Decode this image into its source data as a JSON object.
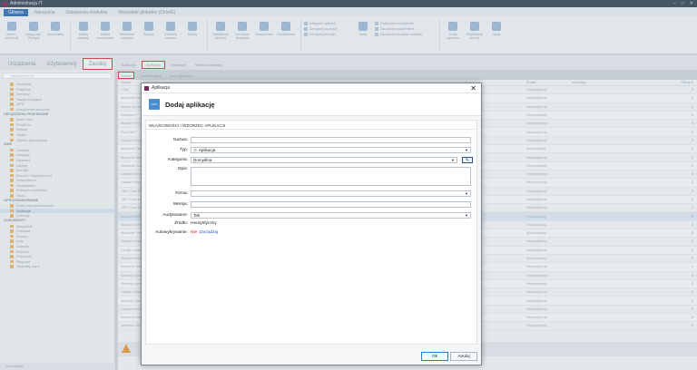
{
  "app": {
    "title": "Administracja IT"
  },
  "menu_tabs": [
    "Główna",
    "Narzędzia",
    "Ustawienia modułów",
    "Wszystkie globalne (CtrlwG)"
  ],
  "ribbon": {
    "buttons": [
      "Zmień / wzmocnij",
      "Zaloguj się / Wyloguj",
      "Komunikaty",
      "Zdalny desktop",
      "Zdalne zarządzanie",
      "Biblioteka urządzeń",
      "Raporty",
      "Dziennik zdarzeń",
      "Alarmy",
      "Ustawienia skanera",
      "Usuwanie zbędnych",
      "Skanuj teraz",
      "Uprawnienia"
    ],
    "list_a": [
      "Kategorie aplikacji",
      "Zarządzaj wzorcami",
      "Konfiguruj licencje"
    ],
    "list_b": [
      "Podłączone urządzenia",
      "Zarządzaj urządzeniami",
      "Zarządzaj zasobami zdalnymi"
    ],
    "tail_buttons": [
      "Audyt",
      "Audyt zgłoszeń",
      "Rejestracja licencji",
      "Opcje"
    ]
  },
  "sub_tabs": [
    "Urządzenia",
    "Użytkownicy",
    "Zasoby"
  ],
  "sub_tabs2": [
    "Aplikacje",
    "Aplikacje",
    "Instalacje",
    "Historia instalacji"
  ],
  "toolbar": {
    "add": "Dodaj",
    "edit": "Zmień/edytuj",
    "delete": "Usuń aplikacje"
  },
  "sidebar": {
    "search_placeholder": "Szukaj (Ctrl+F)",
    "items": [
      {
        "type": "it",
        "label": "Drukarka"
      },
      {
        "type": "it",
        "label": "Projektor"
      },
      {
        "type": "it",
        "label": "Serwery"
      },
      {
        "type": "it",
        "label": "Stacja dokująca"
      },
      {
        "type": "it",
        "label": "UPS"
      },
      {
        "type": "it",
        "label": "Urządzenie sieciowe"
      },
      {
        "type": "grp",
        "label": "URZĄDZENIA PRZENOŚNE"
      },
      {
        "type": "it",
        "label": "Karta SIM"
      },
      {
        "type": "it",
        "label": "Pendrive"
      },
      {
        "type": "it",
        "label": "Skaner"
      },
      {
        "type": "it",
        "label": "Tablet"
      },
      {
        "type": "it",
        "label": "Telefon komórkowy"
      },
      {
        "type": "grp",
        "label": "INNE"
      },
      {
        "type": "it",
        "label": "Comfort"
      },
      {
        "type": "it",
        "label": "Dostępy"
      },
      {
        "type": "it",
        "label": "Headset"
      },
      {
        "type": "it",
        "label": "Laptop"
      },
      {
        "type": "it",
        "label": "Monitor"
      },
      {
        "type": "it",
        "label": "Mouse / Keyboard set"
      },
      {
        "type": "it",
        "label": "Smartphone"
      },
      {
        "type": "it",
        "label": "Smartwatch"
      },
      {
        "type": "it",
        "label": "Software Unlimited"
      },
      {
        "type": "it",
        "label": "Tools"
      },
      {
        "type": "grp",
        "label": "OPROGRAMOWANIE"
      },
      {
        "type": "it",
        "label": "Audyt oprogramowania"
      },
      {
        "type": "it",
        "label": "Aplikacje",
        "sel": true
      },
      {
        "type": "it",
        "label": "Licencje"
      },
      {
        "type": "grp",
        "label": "DOKUMENTY"
      },
      {
        "type": "it",
        "label": "Wszystkie"
      },
      {
        "type": "it",
        "label": "Contract"
      },
      {
        "type": "it",
        "label": "Invoice"
      },
      {
        "type": "it",
        "label": "Inny"
      },
      {
        "type": "it",
        "label": "License"
      },
      {
        "type": "it",
        "label": "Pictures"
      },
      {
        "type": "it",
        "label": "Protocols"
      },
      {
        "type": "it",
        "label": "Request"
      },
      {
        "type": "it",
        "label": "Warranty card"
      }
    ],
    "footer": "Komunikaty"
  },
  "grid": {
    "headers": [
      "Nazwa",
      "",
      "Źródło",
      "Instalacje",
      "Filtruj: A"
    ],
    "rows": [
      [
        "7-Zip",
        "Heurystyczny",
        "0"
      ],
      [
        "Microsoft Edge",
        "Heurystyczny",
        "0"
      ],
      [
        "Adobe Acrobat",
        "Heurystyczny",
        "0"
      ],
      [
        "Notepad++",
        "Heurystyczny",
        "0"
      ],
      [
        "Mozilla Firefox",
        "Heurystyczny",
        "0"
      ],
      [
        "Paint.NET",
        "Heurystyczny",
        "0"
      ],
      [
        "Google Chrome",
        "Heurystyczny",
        "0"
      ],
      [
        "Microsoft Office",
        "Wzorcowany",
        "1"
      ],
      [
        "Microsoft Teams",
        "Heurystyczny",
        "0"
      ],
      [
        "Microsoft OneDrive",
        "Heurystyczny",
        "1"
      ],
      [
        "Update Service",
        "Heurystyczny",
        "0"
      ],
      [
        "Update Helper",
        "Heurystyczny",
        "1"
      ],
      [
        ".NET Core Runtime",
        "Heurystyczny",
        "0"
      ],
      [
        ".NET Core Host",
        "Heurystyczny",
        "0"
      ],
      [
        ".NET Core SDK",
        "Heurystyczny",
        "1"
      ],
      [
        "Mozilla Maintenance",
        "Wzorcowany",
        "0"
      ],
      [
        "Mozilla Thunderbird",
        "Wzorcowany",
        "0"
      ],
      [
        "Microsoft Visual C++",
        "Wzorcowany",
        "0"
      ],
      [
        "Google Drive",
        "Heurystyczny",
        "1"
      ],
      [
        "Google Update",
        "Heurystyczny",
        "0"
      ],
      [
        "Mozilla Firefox ESR",
        "Wzorcowany",
        "0"
      ],
      [
        "Microsoft Silverlight",
        "Heurystyczny",
        "1"
      ],
      [
        "Security Update",
        "Heurystyczny",
        "0"
      ],
      [
        "Security Update",
        "Heurystyczny",
        "1"
      ],
      [
        "Update Helper",
        "Heurystyczny",
        "0"
      ],
      [
        "Security Update",
        "Heurystyczny",
        "0"
      ],
      [
        "Update Manager",
        "Heurystyczny",
        "0"
      ],
      [
        "Microsoft Edge",
        "Heurystyczny",
        "0"
      ],
      [
        "Windows Driver",
        "Heurystyczny",
        "0"
      ]
    ]
  },
  "dialog": {
    "window_title": "Aplikacja",
    "close": "✕",
    "icon_text": "APP",
    "heading": "Dodaj aplikację",
    "section": "WŁAŚCIWOŚCI I WZORZEC APLIKACJI",
    "labels": {
      "name": "Nazwa:",
      "type": "Typ:",
      "category": "Kategoria:",
      "description": "Opis:",
      "company": "Firma:",
      "version": "Wersja:",
      "audited": "Audytowane:",
      "source": "Źródło:",
      "autodetect": "Autowykrywanie:"
    },
    "values": {
      "name": "",
      "type": "Aplikacja",
      "category": "Domyślna",
      "description": "",
      "company": "",
      "version": "",
      "audited": "Tak",
      "source": "Heurystyczny",
      "autodetect_status": "Nie",
      "autodetect_link": "Zarządzaj"
    },
    "ok": "Ok",
    "cancel": "Anuluj"
  },
  "colors": {
    "accent": "#2f6fb3",
    "highlight_box": "#d63a3a",
    "link": "#1b5cc4",
    "negative": "#dd1111"
  }
}
